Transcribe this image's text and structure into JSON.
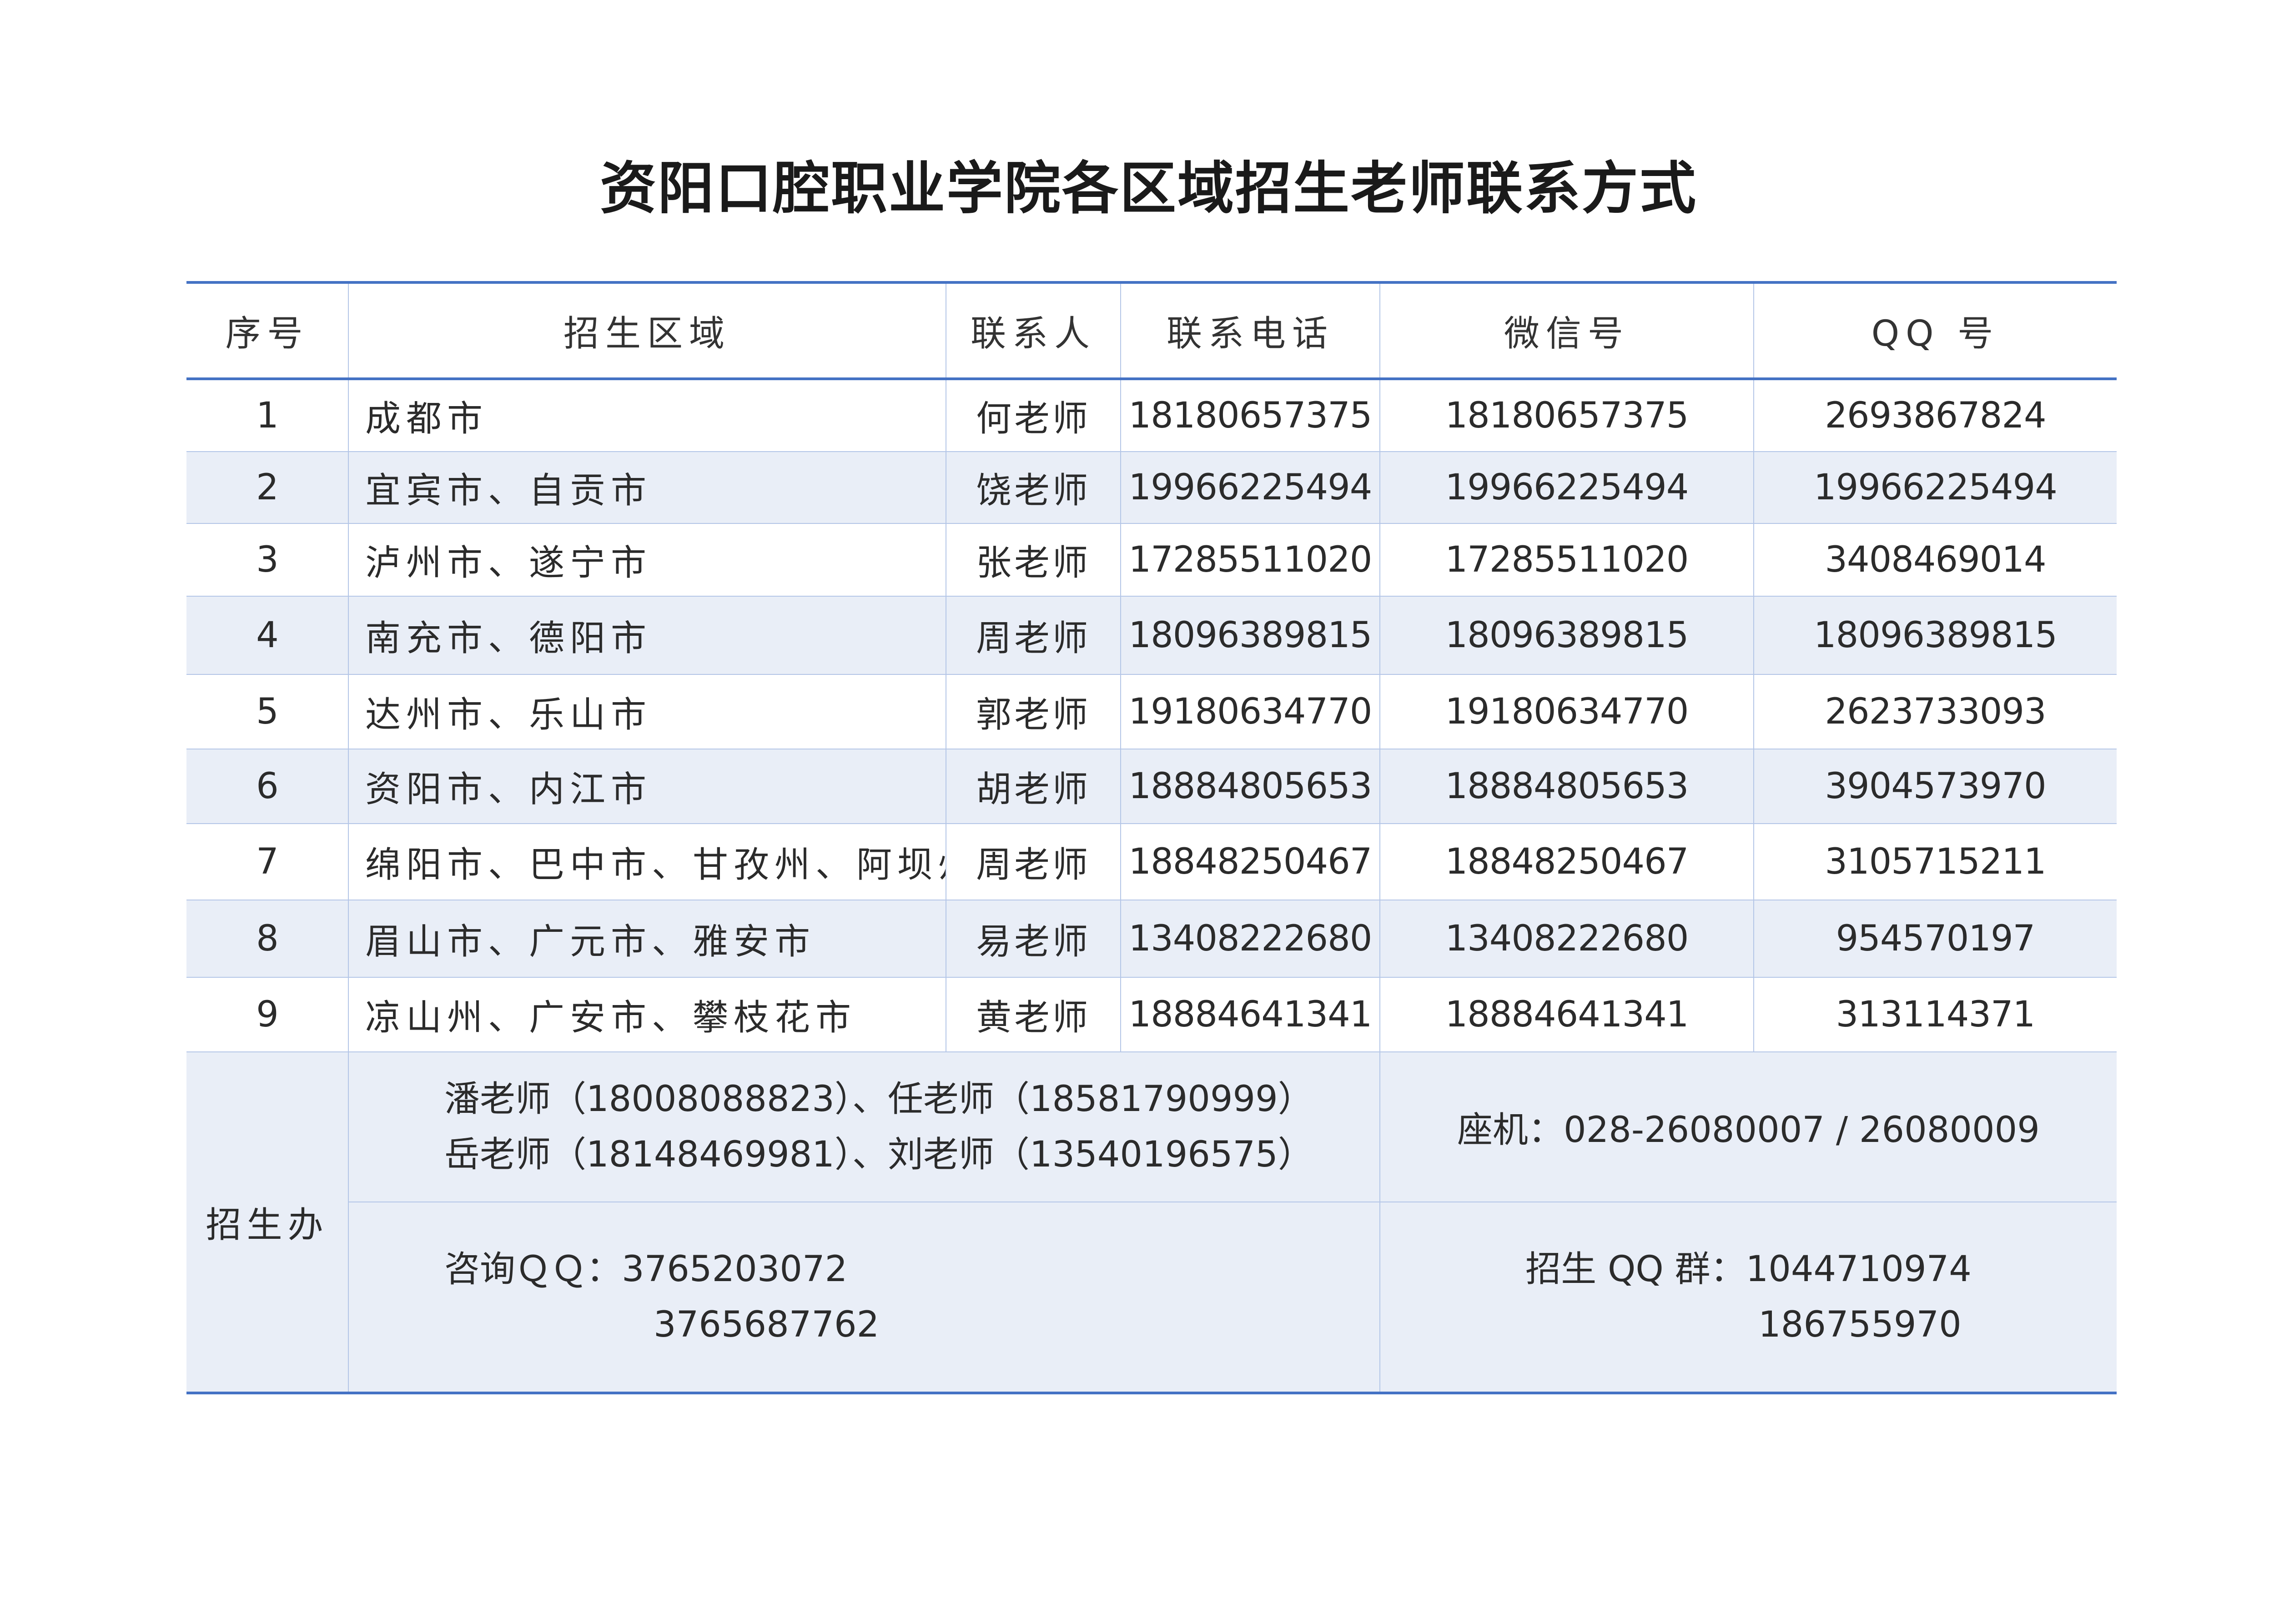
{
  "title": "资阳口腔职业学院各区域招生老师联系方式",
  "header": {
    "index": "序号",
    "region": "招生区域",
    "contact": "联系人",
    "phone": "联系电话",
    "wechat": "微信号",
    "qq": "QQ 号"
  },
  "rows": [
    {
      "index": "1",
      "region": "成都市",
      "contact": "何老师",
      "phone": "18180657375",
      "wechat": "18180657375",
      "qq": "2693867824"
    },
    {
      "index": "2",
      "region": "宜宾市、自贡市",
      "contact": "饶老师",
      "phone": "19966225494",
      "wechat": "19966225494",
      "qq": "19966225494"
    },
    {
      "index": "3",
      "region": "泸州市、遂宁市",
      "contact": "张老师",
      "phone": "17285511020",
      "wechat": "17285511020",
      "qq": "3408469014"
    },
    {
      "index": "4",
      "region": "南充市、德阳市",
      "contact": "周老师",
      "phone": "18096389815",
      "wechat": "18096389815",
      "qq": "18096389815"
    },
    {
      "index": "5",
      "region": "达州市、乐山市",
      "contact": "郭老师",
      "phone": "19180634770",
      "wechat": "19180634770",
      "qq": "2623733093"
    },
    {
      "index": "6",
      "region": "资阳市、内江市",
      "contact": "胡老师",
      "phone": "18884805653",
      "wechat": "18884805653",
      "qq": "3904573970"
    },
    {
      "index": "7",
      "region": "绵阳市、巴中市、甘孜州、阿坝州",
      "contact": "周老师",
      "phone": "18848250467",
      "wechat": "18848250467",
      "qq": "3105715211"
    },
    {
      "index": "8",
      "region": "眉山市、广元市、雅安市",
      "contact": "易老师",
      "phone": "13408222680",
      "wechat": "13408222680",
      "qq": "954570197"
    },
    {
      "index": "9",
      "region": "凉山州、广安市、攀枝花市",
      "contact": "黄老师",
      "phone": "18884641341",
      "wechat": "18884641341",
      "qq": "313114371"
    }
  ],
  "office": {
    "label": "招生办",
    "teachers_line1": "潘老师（18008088823）、任老师（18581790999）",
    "teachers_line2": "岳老师（18148469981）、刘老师（13540196575）",
    "landline": "座机：028-26080007 / 26080009",
    "consult_qq_label": "咨询ＱＱ：",
    "consult_qq_1": "3765203072",
    "consult_qq_2": "3765687762",
    "group_qq_label": "招生 QQ 群：",
    "group_qq_1": "1044710974",
    "group_qq_2": "186755970"
  },
  "colors": {
    "accent_border": "#4472c4",
    "grid_border": "#b4c6e7",
    "row_alt_bg": "#e9eef7"
  }
}
